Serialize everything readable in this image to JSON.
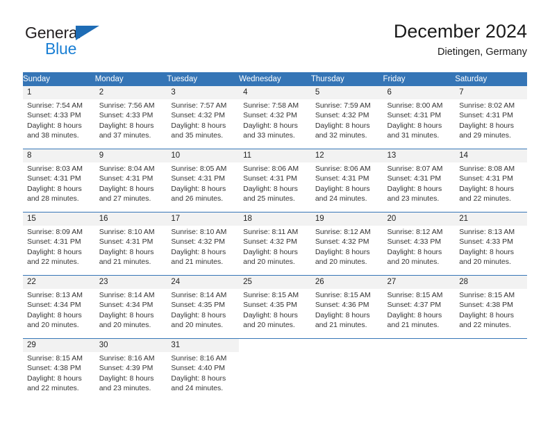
{
  "brand": {
    "name_part1": "General",
    "name_part2": "Blue",
    "triangle_icon": "triangle-icon",
    "colors": {
      "dark": "#231f20",
      "blue": "#1a7fd4",
      "triangle": "#1e6cb5"
    }
  },
  "header": {
    "title": "December 2024",
    "subtitle": "Dietingen, Germany"
  },
  "theme": {
    "header_bg": "#3575b6",
    "header_text": "#ffffff",
    "daynum_bg": "#f2f2f2",
    "grid_line": "#3575b6"
  },
  "weekdays": [
    "Sunday",
    "Monday",
    "Tuesday",
    "Wednesday",
    "Thursday",
    "Friday",
    "Saturday"
  ],
  "weeks": [
    [
      {
        "day": "1",
        "sunrise": "Sunrise: 7:54 AM",
        "sunset": "Sunset: 4:33 PM",
        "daylight1": "Daylight: 8 hours",
        "daylight2": "and 38 minutes."
      },
      {
        "day": "2",
        "sunrise": "Sunrise: 7:56 AM",
        "sunset": "Sunset: 4:33 PM",
        "daylight1": "Daylight: 8 hours",
        "daylight2": "and 37 minutes."
      },
      {
        "day": "3",
        "sunrise": "Sunrise: 7:57 AM",
        "sunset": "Sunset: 4:32 PM",
        "daylight1": "Daylight: 8 hours",
        "daylight2": "and 35 minutes."
      },
      {
        "day": "4",
        "sunrise": "Sunrise: 7:58 AM",
        "sunset": "Sunset: 4:32 PM",
        "daylight1": "Daylight: 8 hours",
        "daylight2": "and 33 minutes."
      },
      {
        "day": "5",
        "sunrise": "Sunrise: 7:59 AM",
        "sunset": "Sunset: 4:32 PM",
        "daylight1": "Daylight: 8 hours",
        "daylight2": "and 32 minutes."
      },
      {
        "day": "6",
        "sunrise": "Sunrise: 8:00 AM",
        "sunset": "Sunset: 4:31 PM",
        "daylight1": "Daylight: 8 hours",
        "daylight2": "and 31 minutes."
      },
      {
        "day": "7",
        "sunrise": "Sunrise: 8:02 AM",
        "sunset": "Sunset: 4:31 PM",
        "daylight1": "Daylight: 8 hours",
        "daylight2": "and 29 minutes."
      }
    ],
    [
      {
        "day": "8",
        "sunrise": "Sunrise: 8:03 AM",
        "sunset": "Sunset: 4:31 PM",
        "daylight1": "Daylight: 8 hours",
        "daylight2": "and 28 minutes."
      },
      {
        "day": "9",
        "sunrise": "Sunrise: 8:04 AM",
        "sunset": "Sunset: 4:31 PM",
        "daylight1": "Daylight: 8 hours",
        "daylight2": "and 27 minutes."
      },
      {
        "day": "10",
        "sunrise": "Sunrise: 8:05 AM",
        "sunset": "Sunset: 4:31 PM",
        "daylight1": "Daylight: 8 hours",
        "daylight2": "and 26 minutes."
      },
      {
        "day": "11",
        "sunrise": "Sunrise: 8:06 AM",
        "sunset": "Sunset: 4:31 PM",
        "daylight1": "Daylight: 8 hours",
        "daylight2": "and 25 minutes."
      },
      {
        "day": "12",
        "sunrise": "Sunrise: 8:06 AM",
        "sunset": "Sunset: 4:31 PM",
        "daylight1": "Daylight: 8 hours",
        "daylight2": "and 24 minutes."
      },
      {
        "day": "13",
        "sunrise": "Sunrise: 8:07 AM",
        "sunset": "Sunset: 4:31 PM",
        "daylight1": "Daylight: 8 hours",
        "daylight2": "and 23 minutes."
      },
      {
        "day": "14",
        "sunrise": "Sunrise: 8:08 AM",
        "sunset": "Sunset: 4:31 PM",
        "daylight1": "Daylight: 8 hours",
        "daylight2": "and 22 minutes."
      }
    ],
    [
      {
        "day": "15",
        "sunrise": "Sunrise: 8:09 AM",
        "sunset": "Sunset: 4:31 PM",
        "daylight1": "Daylight: 8 hours",
        "daylight2": "and 22 minutes."
      },
      {
        "day": "16",
        "sunrise": "Sunrise: 8:10 AM",
        "sunset": "Sunset: 4:31 PM",
        "daylight1": "Daylight: 8 hours",
        "daylight2": "and 21 minutes."
      },
      {
        "day": "17",
        "sunrise": "Sunrise: 8:10 AM",
        "sunset": "Sunset: 4:32 PM",
        "daylight1": "Daylight: 8 hours",
        "daylight2": "and 21 minutes."
      },
      {
        "day": "18",
        "sunrise": "Sunrise: 8:11 AM",
        "sunset": "Sunset: 4:32 PM",
        "daylight1": "Daylight: 8 hours",
        "daylight2": "and 20 minutes."
      },
      {
        "day": "19",
        "sunrise": "Sunrise: 8:12 AM",
        "sunset": "Sunset: 4:32 PM",
        "daylight1": "Daylight: 8 hours",
        "daylight2": "and 20 minutes."
      },
      {
        "day": "20",
        "sunrise": "Sunrise: 8:12 AM",
        "sunset": "Sunset: 4:33 PM",
        "daylight1": "Daylight: 8 hours",
        "daylight2": "and 20 minutes."
      },
      {
        "day": "21",
        "sunrise": "Sunrise: 8:13 AM",
        "sunset": "Sunset: 4:33 PM",
        "daylight1": "Daylight: 8 hours",
        "daylight2": "and 20 minutes."
      }
    ],
    [
      {
        "day": "22",
        "sunrise": "Sunrise: 8:13 AM",
        "sunset": "Sunset: 4:34 PM",
        "daylight1": "Daylight: 8 hours",
        "daylight2": "and 20 minutes."
      },
      {
        "day": "23",
        "sunrise": "Sunrise: 8:14 AM",
        "sunset": "Sunset: 4:34 PM",
        "daylight1": "Daylight: 8 hours",
        "daylight2": "and 20 minutes."
      },
      {
        "day": "24",
        "sunrise": "Sunrise: 8:14 AM",
        "sunset": "Sunset: 4:35 PM",
        "daylight1": "Daylight: 8 hours",
        "daylight2": "and 20 minutes."
      },
      {
        "day": "25",
        "sunrise": "Sunrise: 8:15 AM",
        "sunset": "Sunset: 4:35 PM",
        "daylight1": "Daylight: 8 hours",
        "daylight2": "and 20 minutes."
      },
      {
        "day": "26",
        "sunrise": "Sunrise: 8:15 AM",
        "sunset": "Sunset: 4:36 PM",
        "daylight1": "Daylight: 8 hours",
        "daylight2": "and 21 minutes."
      },
      {
        "day": "27",
        "sunrise": "Sunrise: 8:15 AM",
        "sunset": "Sunset: 4:37 PM",
        "daylight1": "Daylight: 8 hours",
        "daylight2": "and 21 minutes."
      },
      {
        "day": "28",
        "sunrise": "Sunrise: 8:15 AM",
        "sunset": "Sunset: 4:38 PM",
        "daylight1": "Daylight: 8 hours",
        "daylight2": "and 22 minutes."
      }
    ],
    [
      {
        "day": "29",
        "sunrise": "Sunrise: 8:15 AM",
        "sunset": "Sunset: 4:38 PM",
        "daylight1": "Daylight: 8 hours",
        "daylight2": "and 22 minutes."
      },
      {
        "day": "30",
        "sunrise": "Sunrise: 8:16 AM",
        "sunset": "Sunset: 4:39 PM",
        "daylight1": "Daylight: 8 hours",
        "daylight2": "and 23 minutes."
      },
      {
        "day": "31",
        "sunrise": "Sunrise: 8:16 AM",
        "sunset": "Sunset: 4:40 PM",
        "daylight1": "Daylight: 8 hours",
        "daylight2": "and 24 minutes."
      },
      {
        "day": "",
        "sunrise": "",
        "sunset": "",
        "daylight1": "",
        "daylight2": ""
      },
      {
        "day": "",
        "sunrise": "",
        "sunset": "",
        "daylight1": "",
        "daylight2": ""
      },
      {
        "day": "",
        "sunrise": "",
        "sunset": "",
        "daylight1": "",
        "daylight2": ""
      },
      {
        "day": "",
        "sunrise": "",
        "sunset": "",
        "daylight1": "",
        "daylight2": ""
      }
    ]
  ]
}
